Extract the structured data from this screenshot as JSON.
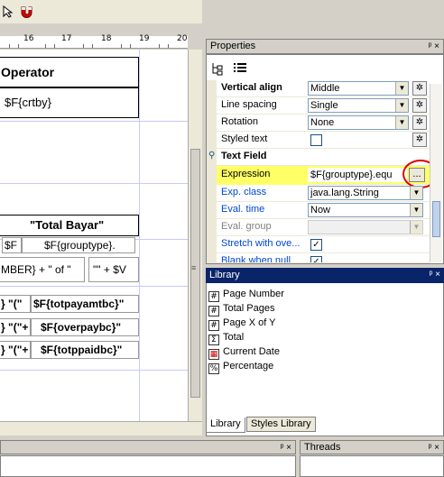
{
  "toolbar": {
    "icons": [
      "cursor-icon",
      "magnet-icon"
    ]
  },
  "ruler": {
    "ticks": [
      "16",
      "17",
      "18",
      "19",
      "20"
    ]
  },
  "report": {
    "operator_label": "Operator",
    "crtby_field": "$F{crtby}",
    "total_bayar_header": "\"Total Bayar\"",
    "f_cell": "$F",
    "grouptype_cell": "$F{grouptype}.",
    "page_expr_left": "MBER} + \" of \"",
    "page_expr_right": "\"\" + $V",
    "rows": [
      {
        "left": "} \"(\"",
        "right": "$F{totpayamtbc}\""
      },
      {
        "left": "} \"(\"+",
        "right": "$F{overpaybc}\""
      },
      {
        "left": "} \"(\"+",
        "right": "$F{totppaidbc}\""
      }
    ]
  },
  "properties": {
    "title": "Properties",
    "pin": "ᵖ ×",
    "rows": [
      {
        "name": "Vertical align",
        "value": "Middle",
        "kind": "select"
      },
      {
        "name": "Line spacing",
        "value": "Single",
        "kind": "select"
      },
      {
        "name": "Rotation",
        "value": "None",
        "kind": "select"
      },
      {
        "name": "Styled text",
        "value": "",
        "kind": "checkbox",
        "checked": false
      },
      {
        "name": "Text Field",
        "kind": "section"
      },
      {
        "name": "Expression",
        "value": "$F{grouptype}.equ",
        "kind": "text"
      },
      {
        "name": "Exp. class",
        "value": "java.lang.String",
        "kind": "select"
      },
      {
        "name": "Eval. time",
        "value": "Now",
        "kind": "select"
      },
      {
        "name": "Eval. group",
        "value": "",
        "kind": "select"
      },
      {
        "name": "Stretch with ove...",
        "value": "",
        "kind": "checkbox",
        "checked": true
      },
      {
        "name": "Blank when null",
        "value": "",
        "kind": "checkbox",
        "checked": true
      }
    ],
    "ellipsis": "...",
    "highlight_color": "#ffff66",
    "circle_color": "#e00000"
  },
  "library": {
    "title": "Library",
    "items": [
      {
        "icon": "#",
        "label": "Page Number"
      },
      {
        "icon": "#",
        "label": "Total Pages"
      },
      {
        "icon": "#",
        "label": "Page X of Y"
      },
      {
        "icon": "Σ",
        "label": "Total"
      },
      {
        "icon": "▦",
        "label": "Current Date"
      },
      {
        "icon": "%",
        "label": "Percentage"
      }
    ],
    "tabs": [
      "Library",
      "Styles Library"
    ]
  },
  "threads": {
    "title": "Threads"
  }
}
